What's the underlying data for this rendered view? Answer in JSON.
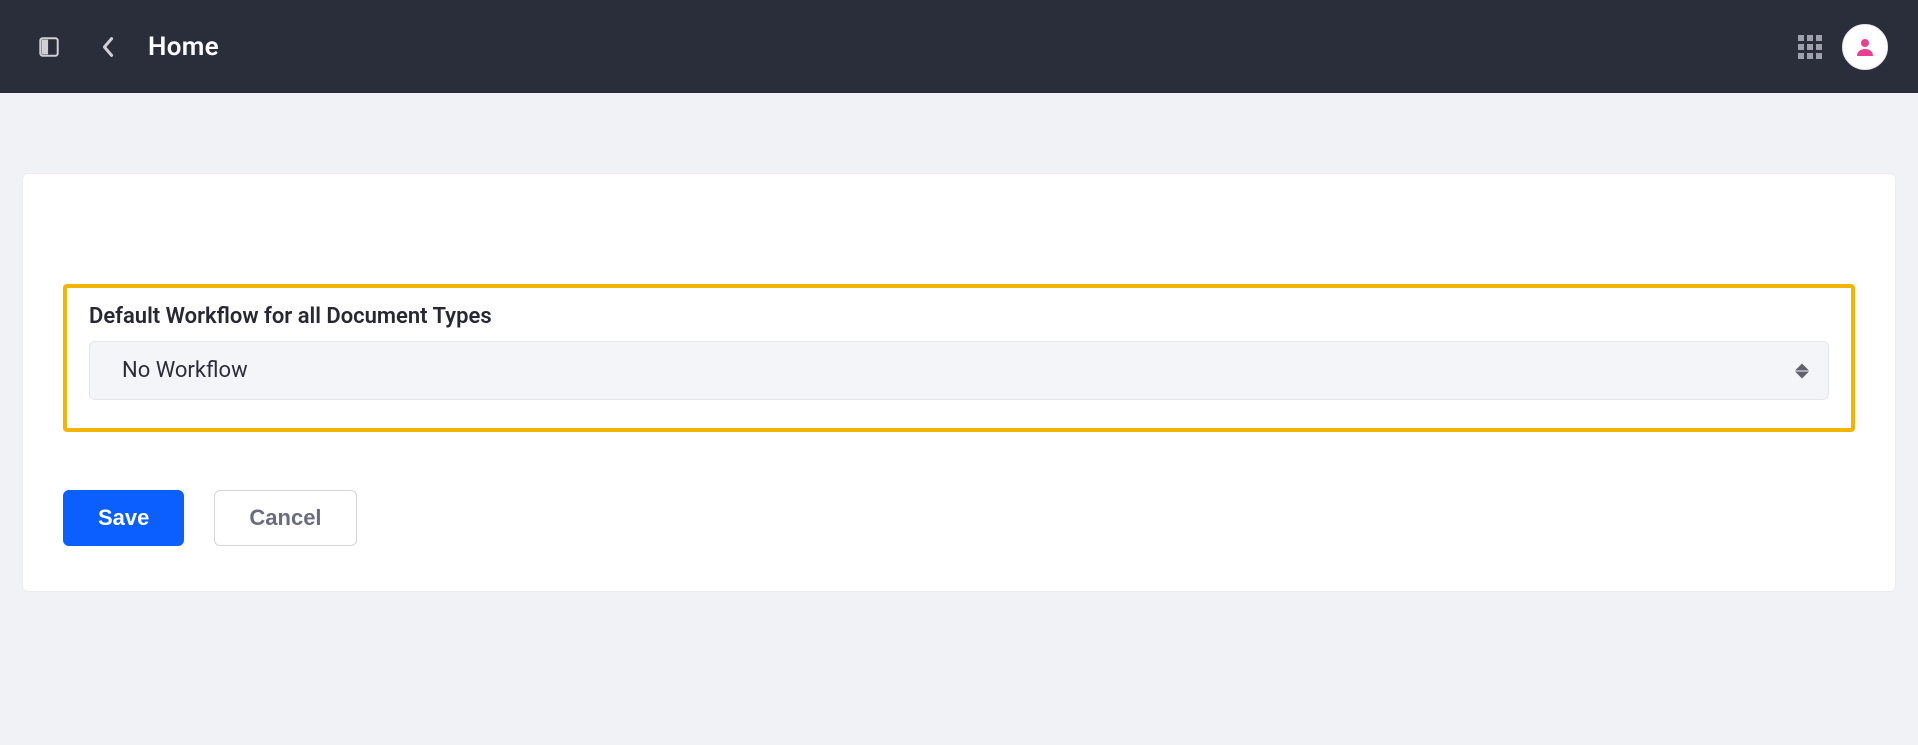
{
  "header": {
    "title": "Home"
  },
  "form": {
    "workflow_label": "Default Workflow for all Document Types",
    "workflow_value": "No Workflow"
  },
  "actions": {
    "save_label": "Save",
    "cancel_label": "Cancel"
  },
  "colors": {
    "accent": "#0b5fff",
    "highlight_border": "#f5b400",
    "header_bg": "#2a2d3a",
    "avatar_icon": "#ec3f93"
  }
}
